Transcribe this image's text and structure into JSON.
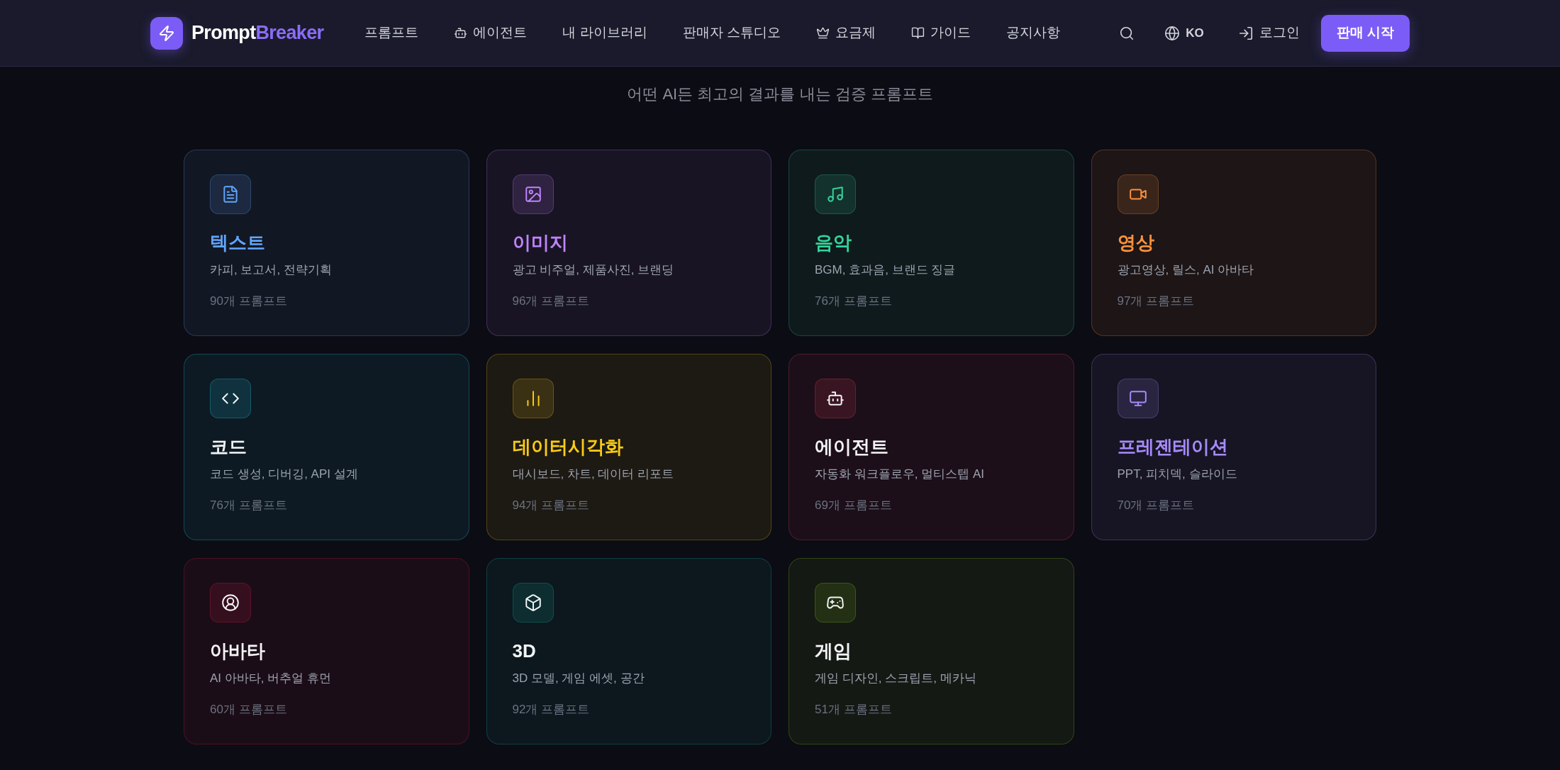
{
  "header": {
    "logo": {
      "first": "Prompt",
      "second": "Breaker"
    },
    "nav": [
      "프롬프트",
      "에이전트",
      "내 라이브러리",
      "판매자 스튜디오",
      "요금제",
      "가이드",
      "공지사항"
    ],
    "language": "KO",
    "login": "로그인",
    "cta": "판매 시작"
  },
  "subtitle": "어떤 AI든 최고의 결과를 내는 검증 프롬프트",
  "categories": [
    {
      "kind": "document",
      "tinted": true,
      "title": "텍스트",
      "description": "카피, 보고서, 전략기획",
      "count": "90개 프롬프트"
    },
    {
      "kind": "image",
      "tinted": true,
      "title": "이미지",
      "description": "광고 비주얼, 제품사진, 브랜딩",
      "count": "96개 프롬프트"
    },
    {
      "kind": "music",
      "tinted": true,
      "title": "음악",
      "description": "BGM, 효과음, 브랜드 징글",
      "count": "76개 프롬프트"
    },
    {
      "kind": "video",
      "tinted": true,
      "title": "영상",
      "description": "광고영상, 릴스, AI 아바타",
      "count": "97개 프롬프트"
    },
    {
      "kind": "code",
      "tinted": false,
      "title": "코드",
      "description": "코드 생성, 디버깅, API 설계",
      "count": "76개 프롬프트"
    },
    {
      "kind": "chart",
      "tinted": true,
      "title": "데이터시각화",
      "description": "대시보드, 차트, 데이터 리포트",
      "count": "94개 프롬프트"
    },
    {
      "kind": "bot",
      "tinted": false,
      "title": "에이전트",
      "description": "자동화 워크플로우, 멀티스텝 AI",
      "count": "69개 프롬프트"
    },
    {
      "kind": "monitor",
      "tinted": true,
      "title": "프레젠테이션",
      "description": "PPT, 피치덱, 슬라이드",
      "count": "70개 프롬프트"
    },
    {
      "kind": "avatar",
      "tinted": false,
      "title": "아바타",
      "description": "AI 아바타, 버추얼 휴먼",
      "count": "60개 프롬프트"
    },
    {
      "kind": "cube",
      "tinted": false,
      "title": "3D",
      "description": "3D 모델, 게임 에셋, 공간",
      "count": "92개 프롬프트"
    },
    {
      "kind": "gamepad",
      "tinted": false,
      "title": "게임",
      "description": "게임 디자인, 스크립트, 메카닉",
      "count": "51개 프롬프트"
    }
  ]
}
